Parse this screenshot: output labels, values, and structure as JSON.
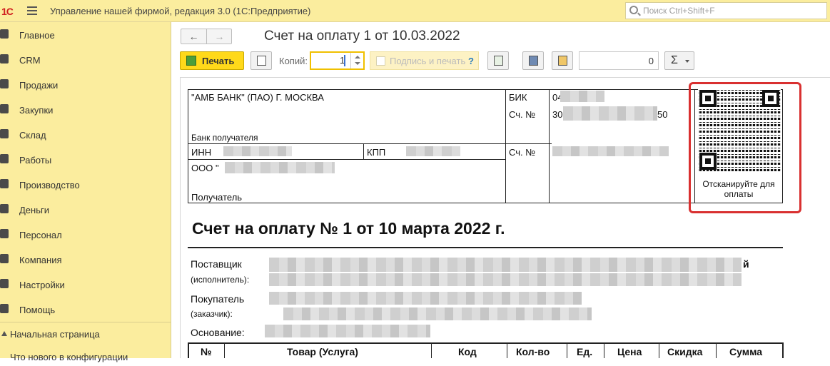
{
  "app": {
    "title": "Управление нашей фирмой, редакция 3.0  (1С:Предприятие)",
    "search_placeholder": "Поиск Ctrl+Shift+F"
  },
  "sidebar": {
    "items": [
      {
        "label": "Главное",
        "icon": "menu-icon"
      },
      {
        "label": "CRM",
        "icon": "crm-icon"
      },
      {
        "label": "Продажи",
        "icon": "cart-icon"
      },
      {
        "label": "Закупки",
        "icon": "truck-icon"
      },
      {
        "label": "Склад",
        "icon": "warehouse-icon"
      },
      {
        "label": "Работы",
        "icon": "tools-icon"
      },
      {
        "label": "Производство",
        "icon": "factory-icon"
      },
      {
        "label": "Деньги",
        "icon": "money-icon"
      },
      {
        "label": "Персонал",
        "icon": "people-icon"
      },
      {
        "label": "Компания",
        "icon": "flag-icon"
      },
      {
        "label": "Настройки",
        "icon": "gear-icon"
      },
      {
        "label": "Помощь",
        "icon": "help-icon"
      }
    ],
    "home": "Начальная страница",
    "whats_new": "Что нового в конфигурации"
  },
  "form": {
    "title": "Счет на оплату 1 от 10.03.2022",
    "back_icon": "arrow-left-icon",
    "forward_icon": "arrow-right-icon"
  },
  "toolbar": {
    "print_label": "Печать",
    "copies_label": "Копий:",
    "copies_value": "1",
    "sign_label": "Подпись и печать",
    "sign_help": "?",
    "sum_value": "0",
    "sigma_label": "Σ"
  },
  "invoice": {
    "bank_name": "\"АМБ БАНК\" (ПАО) Г. МОСКВА",
    "bank_caption": "Банк получателя",
    "bik_label": "БИК",
    "bik_value": "04",
    "acct_label": "Сч. №",
    "acct_value_start": "30",
    "acct_value_end": "50",
    "inn_label": "ИНН",
    "kpp_label": "КПП",
    "acct2_label": "Сч. №",
    "recipient_name": "ООО \"",
    "recipient_caption": "Получатель",
    "qr_caption": "Отсканируйте для оплаты",
    "heading": "Счет на оплату № 1 от 10 марта 2022 г.",
    "supplier_label": "Поставщик",
    "supplier_sub": "(исполнитель):",
    "supplier_tail": "й",
    "buyer_label": "Покупатель",
    "buyer_sub": "(заказчик):",
    "basis_label": "Основание:",
    "table_headers": [
      "№",
      "Товар (Услуга)",
      "Код",
      "Кол-во",
      "Ед.",
      "Цена",
      "Скидка",
      "Сумма"
    ]
  }
}
